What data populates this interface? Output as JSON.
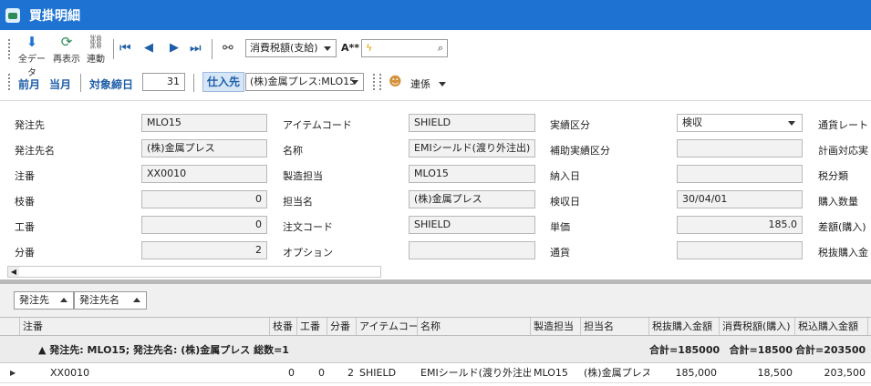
{
  "window": {
    "title": "買掛明細"
  },
  "toolbar": {
    "all_data_label": "全データ",
    "refresh_label": "再表示",
    "link_label": "連動",
    "tax_select_value": "消費税額(支給)",
    "font_label": "A**",
    "prev_month_label": "前月",
    "this_month_label": "当月",
    "closing_day_label": "対象締日",
    "closing_day_value": "31",
    "supplier_label": "仕入先",
    "supplier_select_value": "(株)金属プレス:MLO15",
    "relation_label": "連係"
  },
  "form": {
    "col1": [
      {
        "label": "発注先",
        "value": "MLO15",
        "num": false
      },
      {
        "label": "発注先名",
        "value": "(株)金属プレス",
        "num": false
      },
      {
        "label": "注番",
        "value": "XX0010",
        "num": false
      },
      {
        "label": "枝番",
        "value": "0",
        "num": true
      },
      {
        "label": "工番",
        "value": "0",
        "num": true
      },
      {
        "label": "分番",
        "value": "2",
        "num": true
      }
    ],
    "col2": [
      {
        "label": "アイテムコード",
        "value": "SHIELD",
        "num": false
      },
      {
        "label": "名称",
        "value": "EMIシールド(渡り外注出)",
        "num": false
      },
      {
        "label": "製造担当",
        "value": "MLO15",
        "num": false
      },
      {
        "label": "担当名",
        "value": "(株)金属プレス",
        "num": false
      },
      {
        "label": "注文コード",
        "value": "SHIELD",
        "num": false
      },
      {
        "label": "オプション",
        "value": "",
        "num": false
      }
    ],
    "col3": [
      {
        "label": "実績区分",
        "value": "検収",
        "num": false
      },
      {
        "label": "補助実績区分",
        "value": "",
        "num": false
      },
      {
        "label": "納入日",
        "value": "",
        "num": false
      },
      {
        "label": "検収日",
        "value": "30/04/01",
        "num": false
      },
      {
        "label": "単価",
        "value": "185.0",
        "num": true
      },
      {
        "label": "通貨",
        "value": "",
        "num": false
      }
    ],
    "col4": [
      "通貨レート",
      "計画対応実",
      "税分類",
      "購入数量",
      "差額(購入)",
      "税抜購入金"
    ]
  },
  "grid": {
    "group_chips": [
      "発注先",
      "発注先名"
    ],
    "columns": [
      "注番",
      "枝番",
      "工番",
      "分番",
      "アイテムコード",
      "名称",
      "製造担当",
      "担当名",
      "税抜購入金額",
      "消費税額(購入)",
      "税込購入金額"
    ],
    "group_row": {
      "text": "▲ 発注先: MLO15; 発注先名: (株)金属プレス 総数=1",
      "sum1": "合計=185000",
      "sum2": "合計=18500",
      "sum3": "合計=203500"
    },
    "rows": [
      [
        "XX0010",
        "0",
        "0",
        "2",
        "SHIELD",
        "EMIシールド(渡り外注出)",
        "MLO15",
        "(株)金属プレス",
        "185,000",
        "18,500",
        "203,500"
      ]
    ]
  }
}
